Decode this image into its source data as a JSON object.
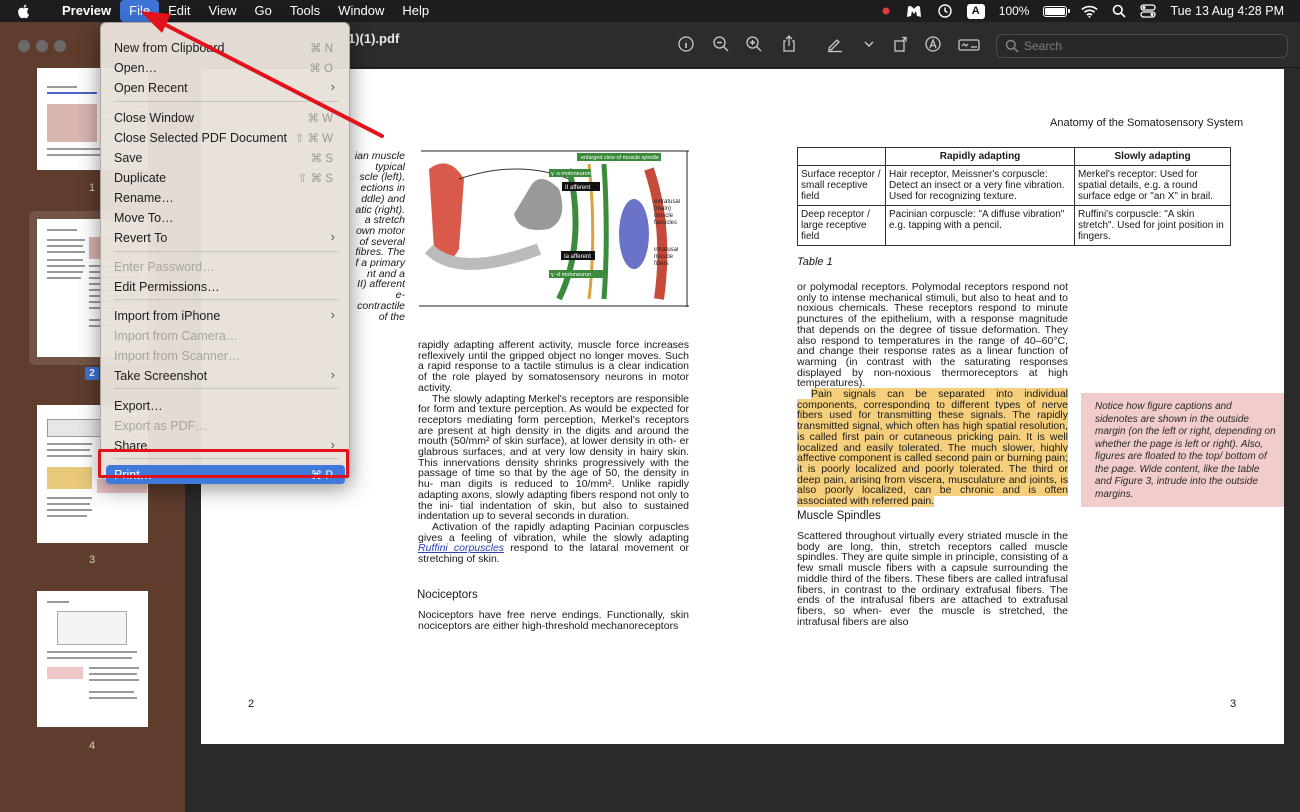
{
  "menubar": {
    "app_name": "Preview",
    "items": [
      "File",
      "Edit",
      "View",
      "Go",
      "Tools",
      "Window",
      "Help"
    ],
    "active_item": "File",
    "battery": "100%",
    "clock": "Tue 13 Aug  4:28 PM",
    "input_badge": "A"
  },
  "window": {
    "title_fragment": "1)(1).pdf",
    "search_placeholder": "Search"
  },
  "sidebar": {
    "pages": [
      "1",
      "2",
      "3",
      "4"
    ],
    "selected_page": "2"
  },
  "file_menu": {
    "items": [
      {
        "label": "New from Clipboard",
        "shortcut": "⌘ N",
        "enabled": true
      },
      {
        "label": "Open…",
        "shortcut": "⌘ O",
        "enabled": true
      },
      {
        "label": "Open Recent",
        "shortcut": "›",
        "enabled": true
      },
      {
        "label": "Close Window",
        "shortcut": "⌘ W",
        "enabled": true
      },
      {
        "label": "Close Selected PDF Document",
        "shortcut": "⇧ ⌘ W",
        "enabled": true
      },
      {
        "label": "Save",
        "shortcut": "⌘ S",
        "enabled": true
      },
      {
        "label": "Duplicate",
        "shortcut": "⇧ ⌘ S",
        "enabled": true
      },
      {
        "label": "Rename…",
        "shortcut": "",
        "enabled": true
      },
      {
        "label": "Move To…",
        "shortcut": "",
        "enabled": true
      },
      {
        "label": "Revert To",
        "shortcut": "›",
        "enabled": true
      },
      {
        "label": "Enter Password…",
        "shortcut": "",
        "enabled": false
      },
      {
        "label": "Edit Permissions…",
        "shortcut": "",
        "enabled": true
      },
      {
        "label": "Import from iPhone",
        "shortcut": "›",
        "enabled": true
      },
      {
        "label": "Import from Camera…",
        "shortcut": "",
        "enabled": false
      },
      {
        "label": "Import from Scanner…",
        "shortcut": "",
        "enabled": false
      },
      {
        "label": "Take Screenshot",
        "shortcut": "›",
        "enabled": true
      },
      {
        "label": "Export…",
        "shortcut": "",
        "enabled": true
      },
      {
        "label": "Export as PDF…",
        "shortcut": "",
        "enabled": false
      },
      {
        "label": "Share",
        "shortcut": "›",
        "enabled": true
      },
      {
        "label": "Print…",
        "shortcut": "⌘ P",
        "enabled": true,
        "highlighted": true
      }
    ]
  },
  "document": {
    "running_head": "Anatomy of the Somatosensory System",
    "page_left": "2",
    "page_right": "3",
    "left_col_fragment": [
      "ian muscle",
      "typical",
      "scle (left),",
      "ections in",
      "ddle) and",
      "atic (right).",
      "a stretch",
      "own motor",
      "of several",
      "fibres. The",
      "f a primary",
      "nt and a",
      "II) afferent",
      "e-contractile",
      "of the"
    ],
    "figure_labels": {
      "banner": "enlarged view of muscle spindle",
      "gamma_s": "γ -s motoneuron",
      "ii_afferent": "II afferent",
      "ia_afferent": "Ia afferent",
      "gamma_d": "γ -d motoneuron",
      "extrafusal": "extrafusal (main) muscle fascicles",
      "intrafusal": "intrafusal muscle fibers"
    },
    "col2_para1": "rapidly adapting afferent activity, muscle force increases reflexively until the gripped object no longer moves. Such a rapid response to a tactile stimulus is a clear indication of the role played by somatosensory neurons in motor activity.",
    "col2_para2": "The slowly adapting Merkel's receptors are responsible for form and texture perception. As would be expected for receptors mediating form perception, Merkel's receptors are present at high density in the digits and around the mouth (50/mm² of skin surface), at lower density in oth- er glabrous surfaces, and at very low density in hairy skin. This innervations density shrinks progressively with the passage of time so that by the age of 50, the density in hu- man digits is reduced to 10/mm². Unlike rapidly adapting axons, slowly adapting fibers respond not only to the ini- tial indentation of skin, but also to sustained indentation up to several seconds in duration.",
    "col2_para3_a": "Activation of the rapidly adapting Pacinian corpuscles gives a feeling of vibration, while the slowly adapting",
    "col2_para3_link": "Ruffini corpuscles",
    "col2_para3_b": "respond to the lataral movement or stretching of skin.",
    "noci_head": "Nociceptors",
    "noci_text": "Nociceptors have free nerve endings. Functionally, skin nociceptors are either high-threshold mechanoreceptors",
    "table": {
      "headers": [
        "",
        "Rapidly adapting",
        "Slowly adapting"
      ],
      "rows": [
        [
          "Surface receptor / small receptive field",
          "Hair receptor, Meissner's corpuscle: Detect an insect or a very fine vibration. Used for recognizing texture.",
          "Merkel's receptor: Used for spatial details, e.g. a round surface edge or \"an X\" in brail."
        ],
        [
          "Deep receptor / large receptive field",
          "Pacinian corpuscle: \"A diffuse vibration\" e.g. tapping with a pencil.",
          "Ruffini's corpuscle: \"A skin stretch\". Used for joint position in fingers."
        ]
      ]
    },
    "table_caption": "Table 1",
    "col3_para1": "or polymodal receptors. Polymodal receptors respond not only to intense mechanical stimuli, but also to heat and to noxious chemicals. These receptors respond to minute punctures of the epithelium, with a response magnitude that depends on the degree of tissue deformation. They also respond to temperatures in the range of 40–60°C, and change their response rates as a linear function of warming (in contrast with the saturating responses displayed by non-noxious thermoreceptors at high temperatures).",
    "col3_para2": "Pain signals can be separated into individual components, corresponding to different types of nerve fibers used for transmitting these signals. The rapidly transmitted signal, which often has high spatial resolution, is called first pain or cutaneous pricking pain. It is well localized and easily tolerated. The much slower, highly affective component is called second pain or burning pain; it is poorly localized and poorly tolerated. The third or deep pain, arising from viscera, musculature and joints, is also poorly localized, can be chronic and is often associated with referred pain.",
    "spindle_head": "Muscle Spindles",
    "col3_para3": "Scattered throughout virtually every striated muscle in the body are long, thin, stretch receptors called muscle spindles. They are quite simple in principle, consisting of a few small muscle fibers with a capsule surrounding the middle third of the fibers. These fibers are called intrafusal fibers, in contrast to the ordinary extrafusal fibers. The ends of the intrafusal fibers are attached to extrafusal fibers, so when- ever the muscle is stretched, the intrafusal fibers are also",
    "sidenote": "Notice how figure captions and sidenotes are shown in the outside margin (on the left or right, depending on whether the page is left or right). Also, figures are floated to the top/ bottom of the page. Wide content, like the table and Figure 3, intrude into the outside margins."
  },
  "colors": {
    "menu_highlight": "#3f79db",
    "annotation_red": "#e2121b",
    "sidebar_brown": "#5e3d2d",
    "text_highlight": "#f5cf7c",
    "sidenote_pink": "#f0cccb"
  }
}
